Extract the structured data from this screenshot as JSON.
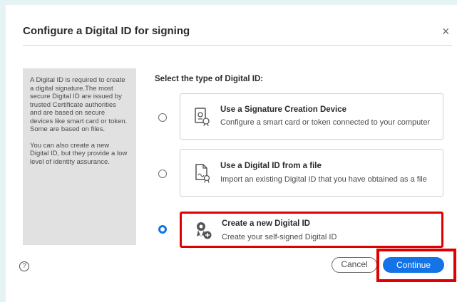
{
  "dialog": {
    "title": "Configure a Digital ID for signing",
    "close_label": "×"
  },
  "info": {
    "paragraph1": "A Digital ID is required to create a digital signature.The most secure Digital ID are issued by trusted Certificate authorities and are based on secure devices like smart card or token. Some are based on files.",
    "paragraph2": "You can also create a new Digital ID, but they provide a low level of identity assurance."
  },
  "section_label": "Select the type of Digital ID:",
  "options": [
    {
      "title": "Use a Signature Creation Device",
      "description": "Configure a smart card or token connected to your computer",
      "icon": "signature-device-icon",
      "selected": false
    },
    {
      "title": "Use a Digital ID from a file",
      "description": "Import an existing Digital ID that you have obtained as a file",
      "icon": "digital-id-file-icon",
      "selected": false
    },
    {
      "title": "Create a new Digital ID",
      "description": "Create your self-signed Digital ID",
      "icon": "create-digital-id-icon",
      "selected": true
    }
  ],
  "footer": {
    "help_label": "?",
    "cancel_label": "Cancel",
    "continue_label": "Continue"
  },
  "colors": {
    "accent": "#1473e6",
    "highlight": "#e00000",
    "info_panel": "#e1e1e1"
  }
}
